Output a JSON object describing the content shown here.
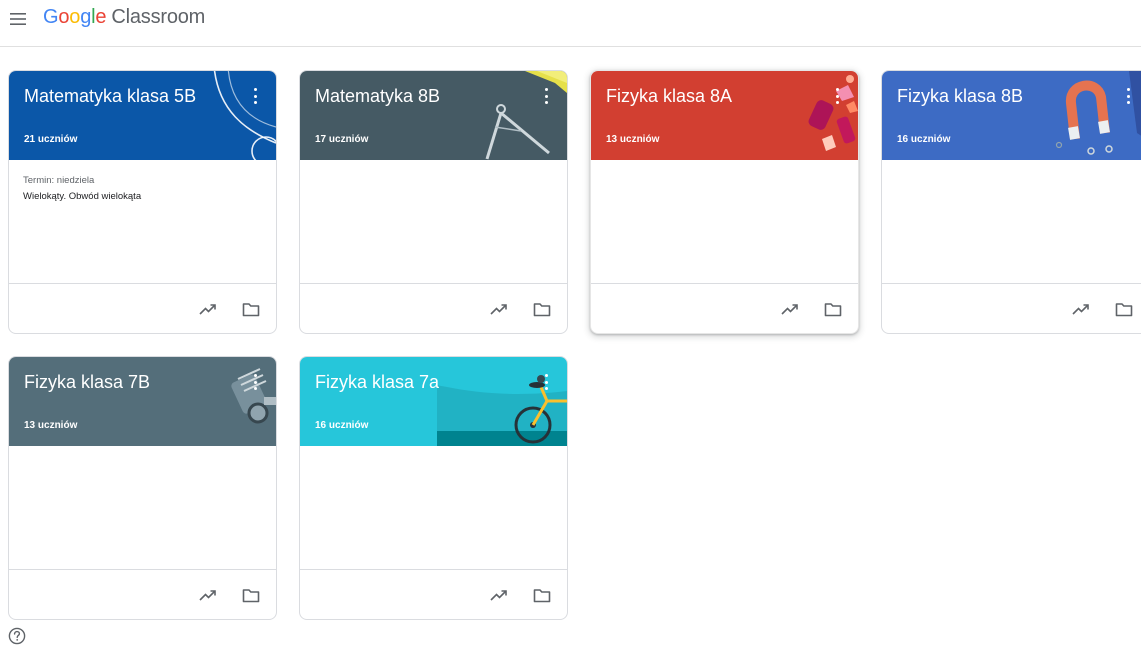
{
  "header": {
    "logo_google": [
      "G",
      "o",
      "o",
      "g",
      "l",
      "e"
    ],
    "logo_product": "Classroom",
    "menu_icon": "hamburger-menu-icon"
  },
  "colors": {
    "google_blue": "#4285F4",
    "google_red": "#EA4335",
    "google_yellow": "#FBBC05",
    "google_green": "#34A853"
  },
  "classes": [
    {
      "title": "Matematyka klasa 5B",
      "students": "21 uczniów",
      "color": "#0b57a8",
      "art": "curve",
      "due_label": "Termin: niedziela",
      "due_item": "Wielokąty. Obwód wielokąta"
    },
    {
      "title": "Matematyka 8B",
      "students": "17 uczniów",
      "color": "#455a64",
      "art": "compass",
      "due_label": "",
      "due_item": ""
    },
    {
      "title": "Fizyka klasa 8A",
      "students": "13 uczniów",
      "color": "#d23f31",
      "art": "shapes",
      "due_label": "",
      "due_item": ""
    },
    {
      "title": "Fizyka klasa 8B",
      "students": "16 uczniów",
      "color": "#3d6bc4",
      "art": "magnet",
      "due_label": "",
      "due_item": ""
    },
    {
      "title": "Fizyka klasa 7B",
      "students": "13 uczniów",
      "color": "#546e7a",
      "art": "engine",
      "due_label": "",
      "due_item": ""
    },
    {
      "title": "Fizyka klasa 7a",
      "students": "16 uczniów",
      "color": "#26c6da",
      "art": "bicycle",
      "due_label": "",
      "due_item": ""
    }
  ],
  "card_icons": {
    "more": "more-vert-icon",
    "trend": "trending-up-icon",
    "folder": "folder-icon"
  },
  "help_icon": "help-icon"
}
